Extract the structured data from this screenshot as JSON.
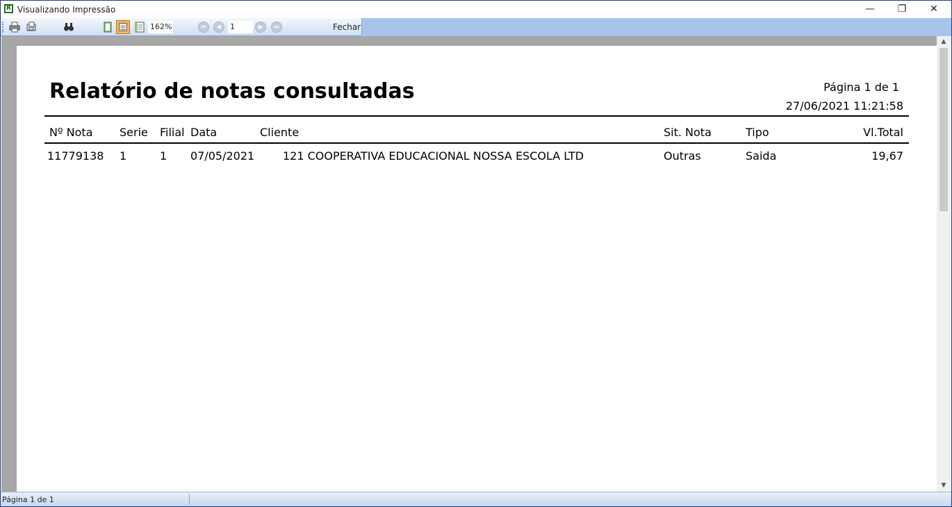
{
  "window": {
    "title": "Visualizando Impressão",
    "app_icon_letter": "R",
    "minimize_glyph": "—",
    "restore_glyph": "❐",
    "close_glyph": "✕"
  },
  "toolbar": {
    "zoom": "162%",
    "page_number": "1",
    "close_label": "Fechar",
    "icons": [
      "printer-icon",
      "page-setup-icon",
      "find-icon",
      "single-page-icon",
      "page-width-icon",
      "multi-page-icon",
      "first-page-icon",
      "previous-page-icon",
      "next-page-icon",
      "last-page-icon"
    ]
  },
  "report": {
    "title": "Relatório de notas consultadas",
    "page_info": "Página 1 de 1",
    "datetime": "27/06/2021 11:21:58",
    "columns": [
      "Nº Nota",
      "Serie",
      "Filial",
      "Data",
      "Cliente",
      "Sit. Nota",
      "Tipo",
      "Vl.Total"
    ],
    "rows": [
      [
        "11779138",
        "1",
        "1",
        "07/05/2021",
        "121 COOPERATIVA EDUCACIONAL NOSSA ESCOLA LTD",
        "Outras",
        "Saida",
        "19,67"
      ]
    ]
  },
  "statusbar": {
    "text": "Página 1 de 1"
  },
  "colors": {
    "accent": "#a8c4ea",
    "active_button": "#f6b45b",
    "preview_background": "#a7a7a7"
  }
}
